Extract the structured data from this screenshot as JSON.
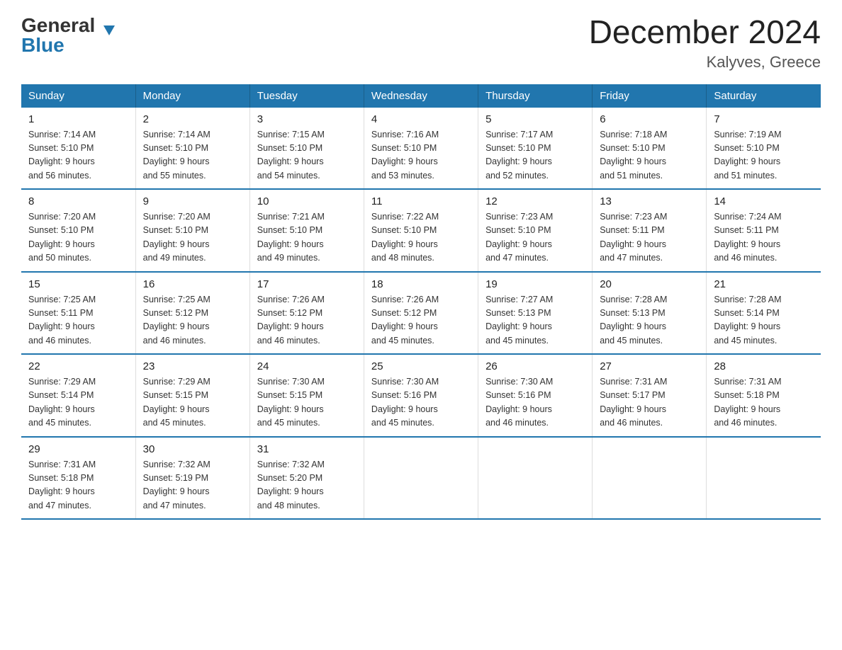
{
  "logo": {
    "general": "General",
    "blue": "Blue"
  },
  "title": "December 2024",
  "subtitle": "Kalyves, Greece",
  "days_header": [
    "Sunday",
    "Monday",
    "Tuesday",
    "Wednesday",
    "Thursday",
    "Friday",
    "Saturday"
  ],
  "weeks": [
    [
      {
        "day": "1",
        "sunrise": "Sunrise: 7:14 AM",
        "sunset": "Sunset: 5:10 PM",
        "daylight": "Daylight: 9 hours",
        "daylight2": "and 56 minutes."
      },
      {
        "day": "2",
        "sunrise": "Sunrise: 7:14 AM",
        "sunset": "Sunset: 5:10 PM",
        "daylight": "Daylight: 9 hours",
        "daylight2": "and 55 minutes."
      },
      {
        "day": "3",
        "sunrise": "Sunrise: 7:15 AM",
        "sunset": "Sunset: 5:10 PM",
        "daylight": "Daylight: 9 hours",
        "daylight2": "and 54 minutes."
      },
      {
        "day": "4",
        "sunrise": "Sunrise: 7:16 AM",
        "sunset": "Sunset: 5:10 PM",
        "daylight": "Daylight: 9 hours",
        "daylight2": "and 53 minutes."
      },
      {
        "day": "5",
        "sunrise": "Sunrise: 7:17 AM",
        "sunset": "Sunset: 5:10 PM",
        "daylight": "Daylight: 9 hours",
        "daylight2": "and 52 minutes."
      },
      {
        "day": "6",
        "sunrise": "Sunrise: 7:18 AM",
        "sunset": "Sunset: 5:10 PM",
        "daylight": "Daylight: 9 hours",
        "daylight2": "and 51 minutes."
      },
      {
        "day": "7",
        "sunrise": "Sunrise: 7:19 AM",
        "sunset": "Sunset: 5:10 PM",
        "daylight": "Daylight: 9 hours",
        "daylight2": "and 51 minutes."
      }
    ],
    [
      {
        "day": "8",
        "sunrise": "Sunrise: 7:20 AM",
        "sunset": "Sunset: 5:10 PM",
        "daylight": "Daylight: 9 hours",
        "daylight2": "and 50 minutes."
      },
      {
        "day": "9",
        "sunrise": "Sunrise: 7:20 AM",
        "sunset": "Sunset: 5:10 PM",
        "daylight": "Daylight: 9 hours",
        "daylight2": "and 49 minutes."
      },
      {
        "day": "10",
        "sunrise": "Sunrise: 7:21 AM",
        "sunset": "Sunset: 5:10 PM",
        "daylight": "Daylight: 9 hours",
        "daylight2": "and 49 minutes."
      },
      {
        "day": "11",
        "sunrise": "Sunrise: 7:22 AM",
        "sunset": "Sunset: 5:10 PM",
        "daylight": "Daylight: 9 hours",
        "daylight2": "and 48 minutes."
      },
      {
        "day": "12",
        "sunrise": "Sunrise: 7:23 AM",
        "sunset": "Sunset: 5:10 PM",
        "daylight": "Daylight: 9 hours",
        "daylight2": "and 47 minutes."
      },
      {
        "day": "13",
        "sunrise": "Sunrise: 7:23 AM",
        "sunset": "Sunset: 5:11 PM",
        "daylight": "Daylight: 9 hours",
        "daylight2": "and 47 minutes."
      },
      {
        "day": "14",
        "sunrise": "Sunrise: 7:24 AM",
        "sunset": "Sunset: 5:11 PM",
        "daylight": "Daylight: 9 hours",
        "daylight2": "and 46 minutes."
      }
    ],
    [
      {
        "day": "15",
        "sunrise": "Sunrise: 7:25 AM",
        "sunset": "Sunset: 5:11 PM",
        "daylight": "Daylight: 9 hours",
        "daylight2": "and 46 minutes."
      },
      {
        "day": "16",
        "sunrise": "Sunrise: 7:25 AM",
        "sunset": "Sunset: 5:12 PM",
        "daylight": "Daylight: 9 hours",
        "daylight2": "and 46 minutes."
      },
      {
        "day": "17",
        "sunrise": "Sunrise: 7:26 AM",
        "sunset": "Sunset: 5:12 PM",
        "daylight": "Daylight: 9 hours",
        "daylight2": "and 46 minutes."
      },
      {
        "day": "18",
        "sunrise": "Sunrise: 7:26 AM",
        "sunset": "Sunset: 5:12 PM",
        "daylight": "Daylight: 9 hours",
        "daylight2": "and 45 minutes."
      },
      {
        "day": "19",
        "sunrise": "Sunrise: 7:27 AM",
        "sunset": "Sunset: 5:13 PM",
        "daylight": "Daylight: 9 hours",
        "daylight2": "and 45 minutes."
      },
      {
        "day": "20",
        "sunrise": "Sunrise: 7:28 AM",
        "sunset": "Sunset: 5:13 PM",
        "daylight": "Daylight: 9 hours",
        "daylight2": "and 45 minutes."
      },
      {
        "day": "21",
        "sunrise": "Sunrise: 7:28 AM",
        "sunset": "Sunset: 5:14 PM",
        "daylight": "Daylight: 9 hours",
        "daylight2": "and 45 minutes."
      }
    ],
    [
      {
        "day": "22",
        "sunrise": "Sunrise: 7:29 AM",
        "sunset": "Sunset: 5:14 PM",
        "daylight": "Daylight: 9 hours",
        "daylight2": "and 45 minutes."
      },
      {
        "day": "23",
        "sunrise": "Sunrise: 7:29 AM",
        "sunset": "Sunset: 5:15 PM",
        "daylight": "Daylight: 9 hours",
        "daylight2": "and 45 minutes."
      },
      {
        "day": "24",
        "sunrise": "Sunrise: 7:30 AM",
        "sunset": "Sunset: 5:15 PM",
        "daylight": "Daylight: 9 hours",
        "daylight2": "and 45 minutes."
      },
      {
        "day": "25",
        "sunrise": "Sunrise: 7:30 AM",
        "sunset": "Sunset: 5:16 PM",
        "daylight": "Daylight: 9 hours",
        "daylight2": "and 45 minutes."
      },
      {
        "day": "26",
        "sunrise": "Sunrise: 7:30 AM",
        "sunset": "Sunset: 5:16 PM",
        "daylight": "Daylight: 9 hours",
        "daylight2": "and 46 minutes."
      },
      {
        "day": "27",
        "sunrise": "Sunrise: 7:31 AM",
        "sunset": "Sunset: 5:17 PM",
        "daylight": "Daylight: 9 hours",
        "daylight2": "and 46 minutes."
      },
      {
        "day": "28",
        "sunrise": "Sunrise: 7:31 AM",
        "sunset": "Sunset: 5:18 PM",
        "daylight": "Daylight: 9 hours",
        "daylight2": "and 46 minutes."
      }
    ],
    [
      {
        "day": "29",
        "sunrise": "Sunrise: 7:31 AM",
        "sunset": "Sunset: 5:18 PM",
        "daylight": "Daylight: 9 hours",
        "daylight2": "and 47 minutes."
      },
      {
        "day": "30",
        "sunrise": "Sunrise: 7:32 AM",
        "sunset": "Sunset: 5:19 PM",
        "daylight": "Daylight: 9 hours",
        "daylight2": "and 47 minutes."
      },
      {
        "day": "31",
        "sunrise": "Sunrise: 7:32 AM",
        "sunset": "Sunset: 5:20 PM",
        "daylight": "Daylight: 9 hours",
        "daylight2": "and 48 minutes."
      },
      {
        "day": "",
        "sunrise": "",
        "sunset": "",
        "daylight": "",
        "daylight2": ""
      },
      {
        "day": "",
        "sunrise": "",
        "sunset": "",
        "daylight": "",
        "daylight2": ""
      },
      {
        "day": "",
        "sunrise": "",
        "sunset": "",
        "daylight": "",
        "daylight2": ""
      },
      {
        "day": "",
        "sunrise": "",
        "sunset": "",
        "daylight": "",
        "daylight2": ""
      }
    ]
  ]
}
